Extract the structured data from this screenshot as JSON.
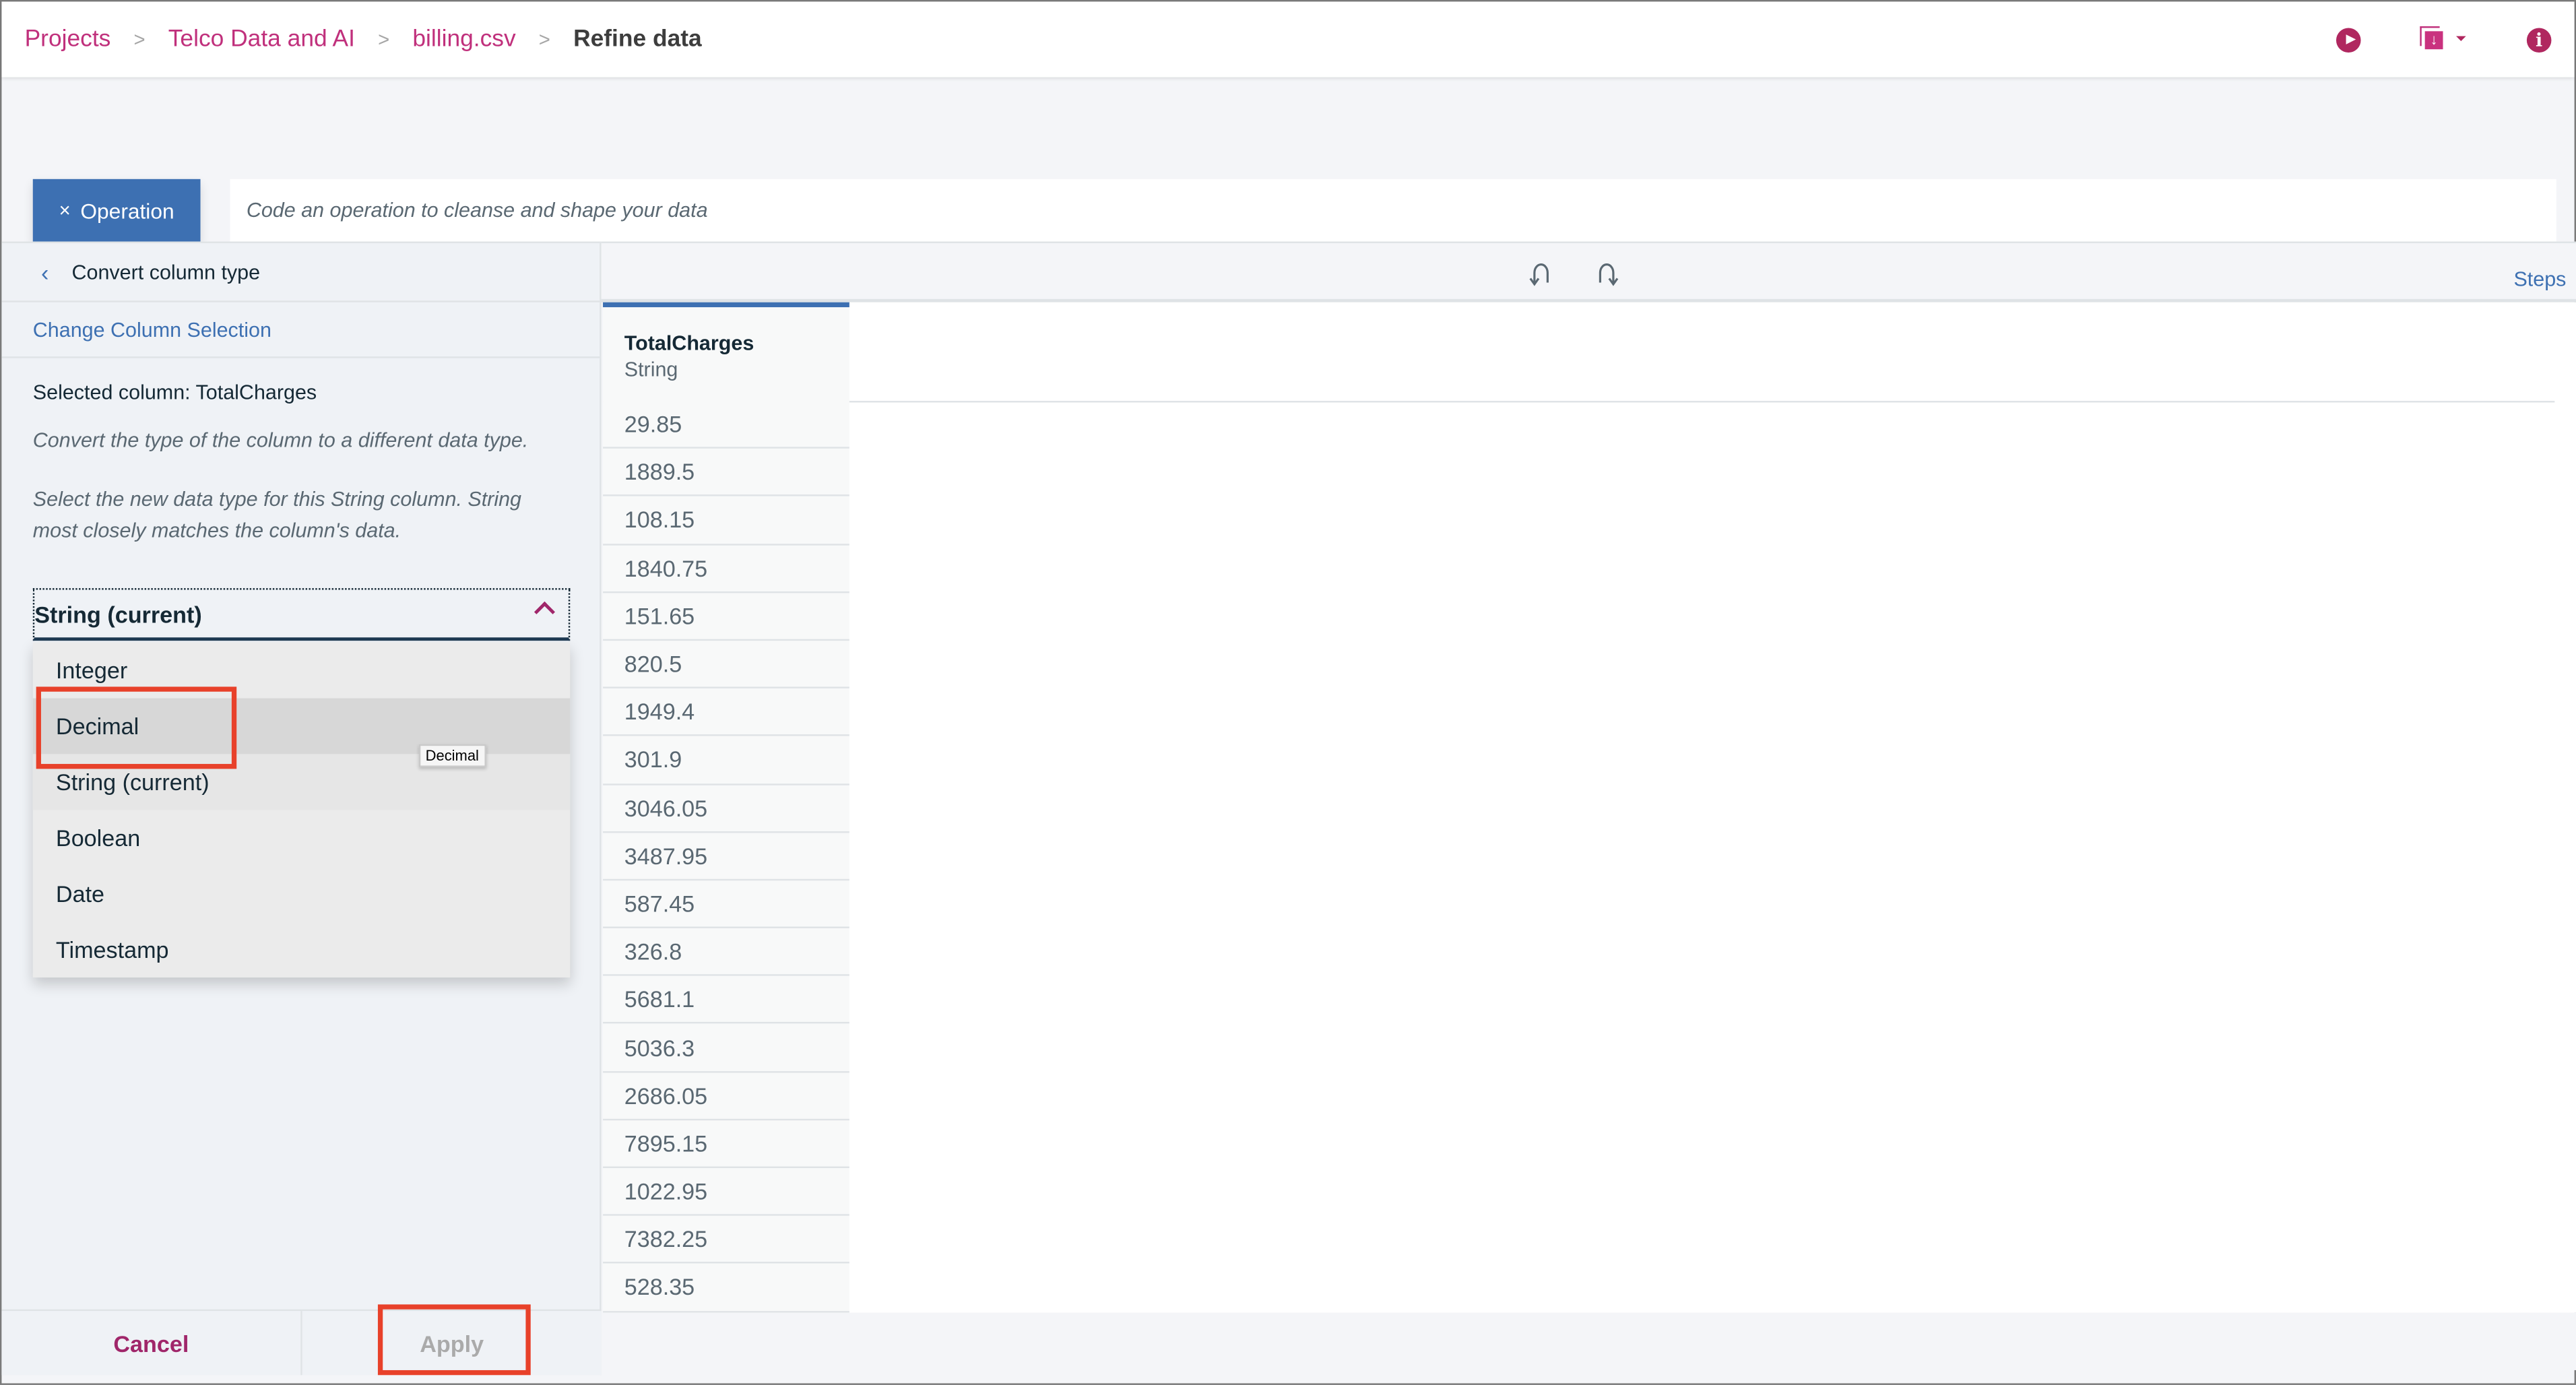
{
  "breadcrumb": {
    "items": [
      "Projects",
      "Telco Data and AI",
      "billing.csv"
    ],
    "current": "Refine data",
    "separator": ">"
  },
  "header_icons": {
    "run": "run-icon",
    "export": "export-download-icon",
    "export_caret": "caret-down-icon",
    "info": "info-icon",
    "info_glyph": "i",
    "export_glyph": "↓"
  },
  "operation": {
    "button_icon": "×",
    "button_label": "Operation",
    "input_placeholder": "Code an operation to cleanse and shape your data",
    "input_value": ""
  },
  "left_panel": {
    "back_icon": "‹",
    "title": "Convert column type",
    "change_selection_link": "Change Column Selection",
    "selected_column_text": "Selected column: TotalCharges",
    "description": "Convert the type of the column to a different data type.",
    "instruction": "Select the new data type for this String column. String most closely matches the column's data.",
    "dropdown": {
      "selected": "String (current)",
      "expanded": true,
      "options": [
        "Integer",
        "Decimal",
        "String (current)",
        "Boolean",
        "Date",
        "Timestamp"
      ],
      "hovered": "Decimal",
      "tooltip": "Decimal"
    },
    "cancel_label": "Cancel",
    "apply_label": "Apply",
    "apply_disabled": true
  },
  "toolbar": {
    "undo_icon": "undo-icon",
    "redo_icon": "redo-icon",
    "steps_label": "Steps"
  },
  "table": {
    "column": {
      "name": "TotalCharges",
      "type": "String"
    },
    "rows": [
      "29.85",
      "1889.5",
      "108.15",
      "1840.75",
      "151.65",
      "820.5",
      "1949.4",
      "301.9",
      "3046.05",
      "3487.95",
      "587.45",
      "326.8",
      "5681.1",
      "5036.3",
      "2686.05",
      "7895.15",
      "1022.95",
      "7382.25",
      "528.35"
    ]
  },
  "colors": {
    "brand_magenta": "#c0307c",
    "primary_blue": "#3d70b2",
    "highlight_red": "#e8412a",
    "text_dark": "#152935",
    "text_muted": "#5a6872"
  }
}
